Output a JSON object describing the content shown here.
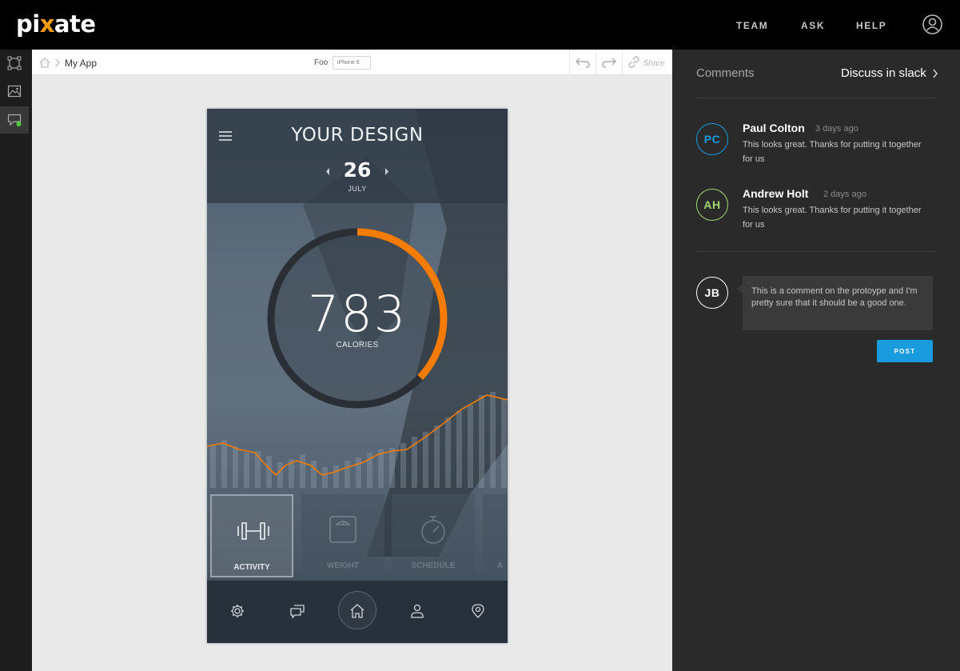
{
  "brand": {
    "logo_pre": "pi",
    "logo_x": "x",
    "logo_post": "ate"
  },
  "topnav": {
    "team": "TEAM",
    "ask": "ASK",
    "help": "HELP"
  },
  "breadcrumb": {
    "app": "My App"
  },
  "canvas_header": {
    "project_label": "Foo",
    "device": "iPhone 6",
    "share_label": "Share"
  },
  "phone": {
    "title": "YOUR DESIGN",
    "date_day": "26",
    "date_month": "JULY",
    "calories_value": "783",
    "calories_label": "CALORIES",
    "calorie_progress": 0.37,
    "tiles": [
      {
        "label": "ACTIVITY",
        "icon": "dumbbell-icon"
      },
      {
        "label": "WEIGHT",
        "icon": "scale-icon"
      },
      {
        "label": "SCHEDULE",
        "icon": "stopwatch-icon"
      },
      {
        "label": "A",
        "icon": "partial-tile"
      }
    ],
    "bottom_nav": [
      "settings-icon",
      "chat-icon",
      "home-icon",
      "profile-icon",
      "location-icon"
    ]
  },
  "comments_panel": {
    "title": "Comments",
    "discuss_link": "Discuss in slack",
    "comments": [
      {
        "initials": "PC",
        "name": "Paul Colton",
        "time": "3 days ago",
        "text": "This looks great. Thanks for putting it together for us",
        "color": "#1a9bdf"
      },
      {
        "initials": "AH",
        "name": "Andrew Holt",
        "time": "2 days ago",
        "text": "This looks great. Thanks for putting it together for us",
        "color": "#a7d870"
      }
    ],
    "draft": {
      "initials": "JB",
      "text": "This is a comment on the protoype and I'm pretty sure that it should be  a good one.",
      "color": "#ffffff"
    },
    "post_label": "POST"
  },
  "colors": {
    "accent_orange": "#f57c00",
    "accent_blue": "#1a9bdf",
    "active_green": "#4cd137"
  }
}
